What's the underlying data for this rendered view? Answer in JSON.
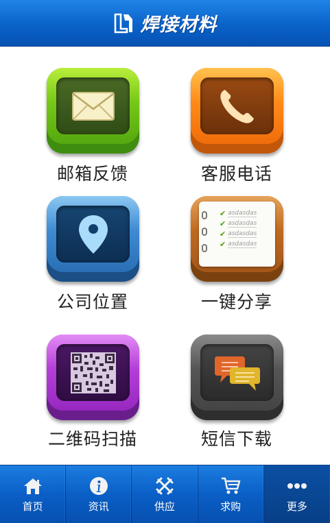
{
  "header": {
    "title": "焊接材料"
  },
  "tiles": [
    {
      "label": "邮箱反馈"
    },
    {
      "label": "客服电话"
    },
    {
      "label": "公司位置"
    },
    {
      "label": "一键分享"
    },
    {
      "label": "二维码扫描"
    },
    {
      "label": "短信下载"
    }
  ],
  "checklist": [
    "asdasdas",
    "asdasdas",
    "asdasdas",
    "asdasdas"
  ],
  "nav": [
    {
      "label": "首页",
      "icon": "home-icon"
    },
    {
      "label": "资讯",
      "icon": "info-icon"
    },
    {
      "label": "供应",
      "icon": "supply-icon"
    },
    {
      "label": "求购",
      "icon": "cart-icon"
    },
    {
      "label": "更多",
      "icon": "more-icon"
    }
  ],
  "colors": {
    "header_blue": "#0a62c9",
    "nav_active": "#0b4fa3",
    "green": "#76c817",
    "orange": "#ff8a18",
    "blue": "#3e8bd3",
    "brown": "#c06a1f",
    "purple": "#b43fd8",
    "grey": "#555555"
  }
}
